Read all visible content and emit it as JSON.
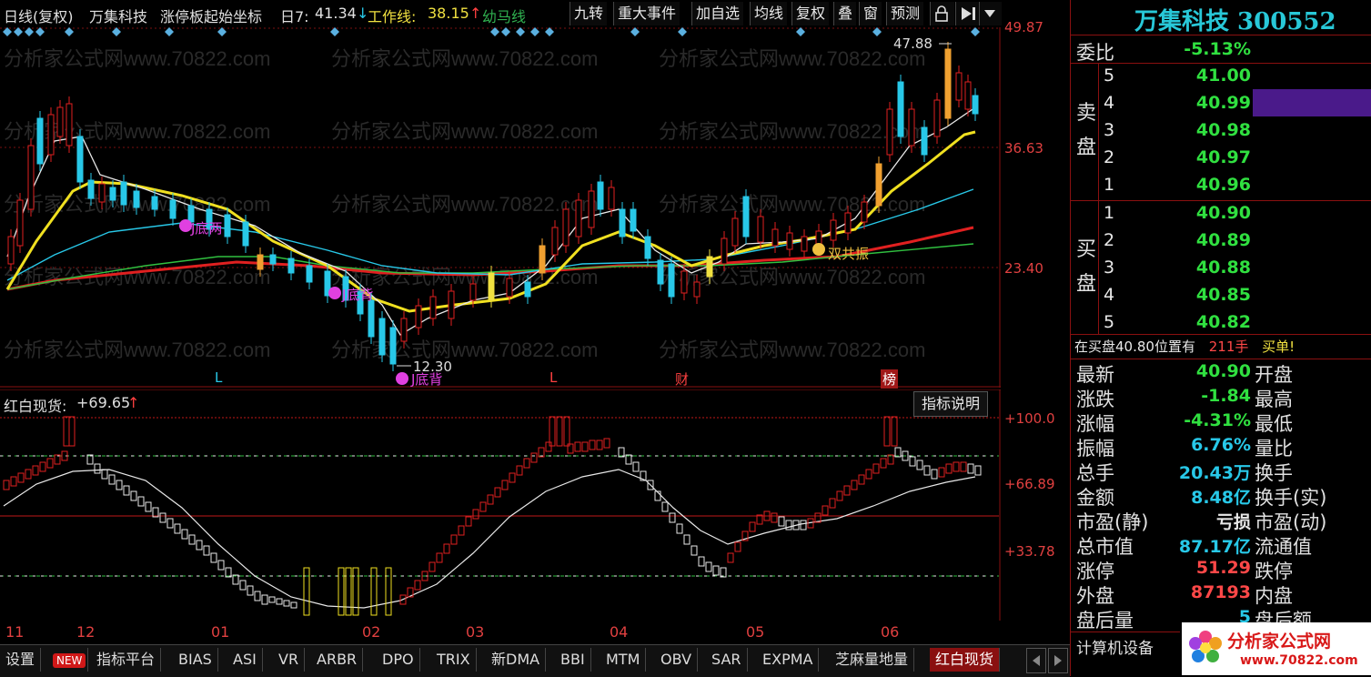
{
  "header": {
    "period": "日线(复权)",
    "stock_name": "万集科技",
    "indicator_name": "涨停板起始坐标",
    "ma7_label": "日7:",
    "ma7_value": "41.34",
    "ma7_arrow": "↓",
    "work_line_label": "工作线:",
    "work_line_value": "38.15",
    "work_line_arrow": "↑",
    "horse_line_label": "幼马线"
  },
  "toolbar": {
    "items": [
      "九转",
      "重大事件",
      "加自选",
      "均线",
      "复权",
      "叠",
      "窗",
      "预测"
    ],
    "lock_icon": "lock-icon",
    "next_icon": "play-next-icon",
    "dropdown_icon": "chevron-down-icon"
  },
  "main_chart": {
    "price_labels": [
      "49.87",
      "36.63",
      "23.40"
    ],
    "high_annotation": "47.88",
    "low_annotation": "12.30",
    "signals": [
      "J底两",
      "J底背",
      "J底背",
      "双共振"
    ],
    "event_markers": [
      "L",
      "L",
      "财",
      "榜"
    ],
    "watermark": "分析家公式网www.70822.com"
  },
  "indicator_chart": {
    "name": "红白现货:",
    "value": "+69.65",
    "arrow": "↑",
    "explain_button": "指标说明",
    "levels": [
      "+100.0",
      "+66.89",
      "+33.78"
    ]
  },
  "x_axis": {
    "labels": [
      "11",
      "12",
      "01",
      "02",
      "03",
      "04",
      "05",
      "06"
    ]
  },
  "bottom_tabs": {
    "settings": "设置",
    "new_badge": "NEW",
    "items": [
      "指标平台",
      "BIAS",
      "ASI",
      "VR",
      "ARBR",
      "DPO",
      "TRIX",
      "新DMA",
      "BBI",
      "MTM",
      "OBV",
      "SAR",
      "EXPMA",
      "芝麻量地量",
      "红白现货"
    ],
    "active": "红白现货"
  },
  "right_panel": {
    "title": "万集科技 300552",
    "weibi_label": "委比",
    "weibi_value": "-5.13%",
    "sell_label": "卖盘",
    "buy_label": "买盘",
    "sell_levels": [
      {
        "level": "5",
        "price": "41.00"
      },
      {
        "level": "4",
        "price": "40.99"
      },
      {
        "level": "3",
        "price": "40.98"
      },
      {
        "level": "2",
        "price": "40.97"
      },
      {
        "level": "1",
        "price": "40.96"
      }
    ],
    "buy_levels": [
      {
        "level": "1",
        "price": "40.90"
      },
      {
        "level": "2",
        "price": "40.89"
      },
      {
        "level": "3",
        "price": "40.88"
      },
      {
        "level": "4",
        "price": "40.85"
      },
      {
        "level": "5",
        "price": "40.82"
      }
    ],
    "notice_text": "在买盘40.80位置有",
    "notice_amount": "211手",
    "notice_tail": "买单!",
    "quotes": [
      {
        "label": "最新",
        "value": "40.90",
        "color": "#30e040",
        "right_label": "开盘"
      },
      {
        "label": "涨跌",
        "value": "-1.84",
        "color": "#30e040",
        "right_label": "最高"
      },
      {
        "label": "涨幅",
        "value": "-4.31%",
        "color": "#30e040",
        "right_label": "最低"
      },
      {
        "label": "振幅",
        "value": "6.76%",
        "color": "#28c8e8",
        "right_label": "量比"
      },
      {
        "label": "总手",
        "value": "20.43万",
        "color": "#28c8e8",
        "right_label": "换手"
      },
      {
        "label": "金额",
        "value": "8.48亿",
        "color": "#28c8e8",
        "right_label": "换手(实)"
      },
      {
        "label": "市盈(静)",
        "value": "亏损",
        "color": "#e8e8e8",
        "right_label": "市盈(动)"
      },
      {
        "label": "总市值",
        "value": "87.17亿",
        "color": "#28c8e8",
        "right_label": "流通值"
      },
      {
        "label": "涨停",
        "value": "51.29",
        "color": "#ff4848",
        "right_label": "跌停"
      },
      {
        "label": "外盘",
        "value": "87193",
        "color": "#ff4848",
        "right_label": "内盘"
      },
      {
        "label": "盘后量",
        "value": "5",
        "color": "#28c8e8",
        "right_label": "盘后额"
      }
    ],
    "sector": "计算机设备",
    "logo_text": "分析家公式网",
    "logo_url": "www.70822.com"
  }
}
